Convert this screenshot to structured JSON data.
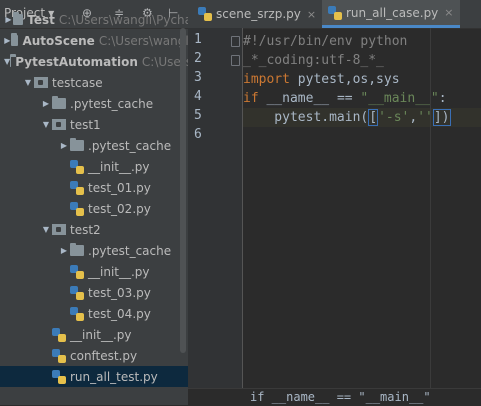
{
  "project_panel": {
    "title": "Project",
    "tools": [
      "⊕",
      "≑",
      "⚙",
      "⊢"
    ]
  },
  "tree": [
    {
      "label": "Test",
      "path": "C:\\Users\\wangli\\Pycha",
      "bold": true,
      "type": "folder",
      "arrow": "▶",
      "indent": 0
    },
    {
      "label": "AutoScene",
      "path": "C:\\Users\\wangli",
      "bold": true,
      "type": "folder",
      "arrow": "▶",
      "indent": 0
    },
    {
      "label": "PytestAutomation",
      "path": "C:\\Users",
      "bold": true,
      "type": "folder",
      "arrow": "▼",
      "indent": 0
    },
    {
      "label": "testcase",
      "path": "",
      "bold": false,
      "type": "pkg",
      "arrow": "▼",
      "indent": 1
    },
    {
      "label": ".pytest_cache",
      "path": "",
      "bold": false,
      "type": "folder",
      "arrow": "▶",
      "indent": 2
    },
    {
      "label": "test1",
      "path": "",
      "bold": false,
      "type": "pkg",
      "arrow": "▼",
      "indent": 2
    },
    {
      "label": ".pytest_cache",
      "path": "",
      "bold": false,
      "type": "folder",
      "arrow": "▶",
      "indent": 3
    },
    {
      "label": "__init__.py",
      "path": "",
      "bold": false,
      "type": "py",
      "arrow": "",
      "indent": 3
    },
    {
      "label": "test_01.py",
      "path": "",
      "bold": false,
      "type": "py",
      "arrow": "",
      "indent": 3
    },
    {
      "label": "test_02.py",
      "path": "",
      "bold": false,
      "type": "py",
      "arrow": "",
      "indent": 3
    },
    {
      "label": "test2",
      "path": "",
      "bold": false,
      "type": "pkg",
      "arrow": "▼",
      "indent": 2
    },
    {
      "label": ".pytest_cache",
      "path": "",
      "bold": false,
      "type": "folder",
      "arrow": "▶",
      "indent": 3
    },
    {
      "label": "__init__.py",
      "path": "",
      "bold": false,
      "type": "py",
      "arrow": "",
      "indent": 3
    },
    {
      "label": "test_03.py",
      "path": "",
      "bold": false,
      "type": "py",
      "arrow": "",
      "indent": 3
    },
    {
      "label": "test_04.py",
      "path": "",
      "bold": false,
      "type": "py",
      "arrow": "",
      "indent": 3
    },
    {
      "label": "__init__.py",
      "path": "",
      "bold": false,
      "type": "py",
      "arrow": "",
      "indent": 2
    },
    {
      "label": "conftest.py",
      "path": "",
      "bold": false,
      "type": "py",
      "arrow": "",
      "indent": 2
    },
    {
      "label": "run_all_test.py",
      "path": "",
      "bold": false,
      "type": "py",
      "arrow": "",
      "indent": 2,
      "selected": true
    }
  ],
  "tabs": [
    {
      "label": "scene_srzp.py",
      "close": "×",
      "active": false
    },
    {
      "label": "run_all_case.py",
      "close": "×",
      "active": true
    }
  ],
  "line_numbers": [
    "1",
    "2",
    "3",
    "4",
    "5",
    "6"
  ],
  "code_lines": [
    {
      "parts": [
        {
          "t": "#!/usr/bin/env python",
          "c": "cmt"
        }
      ]
    },
    {
      "parts": [
        {
          "t": "_*_coding:utf-8_*_",
          "c": "cmt"
        }
      ]
    },
    {
      "parts": [
        {
          "t": "import",
          "c": "kw"
        },
        {
          "t": " pytest,os,sys",
          "c": ""
        }
      ]
    },
    {
      "parts": [
        {
          "t": "if",
          "c": "kw"
        },
        {
          "t": " __name__ ",
          "c": ""
        },
        {
          "t": "==",
          "c": ""
        },
        {
          "t": " ",
          "c": ""
        },
        {
          "t": "\"__main__\"",
          "c": "str"
        },
        {
          "t": ":",
          "c": ""
        }
      ]
    },
    {
      "parts": [
        {
          "t": "    pytest.main(",
          "c": ""
        },
        {
          "t": "[",
          "c": "brk"
        },
        {
          "t": "'-s'",
          "c": "str"
        },
        {
          "t": ",",
          "c": ""
        },
        {
          "t": "''",
          "c": "str"
        },
        {
          "t": "])",
          "c": "brk"
        }
      ],
      "highlight": true
    },
    {
      "parts": [
        {
          "t": "",
          "c": ""
        }
      ]
    }
  ],
  "breadcrumb": "if __name__ == \"__main__\""
}
